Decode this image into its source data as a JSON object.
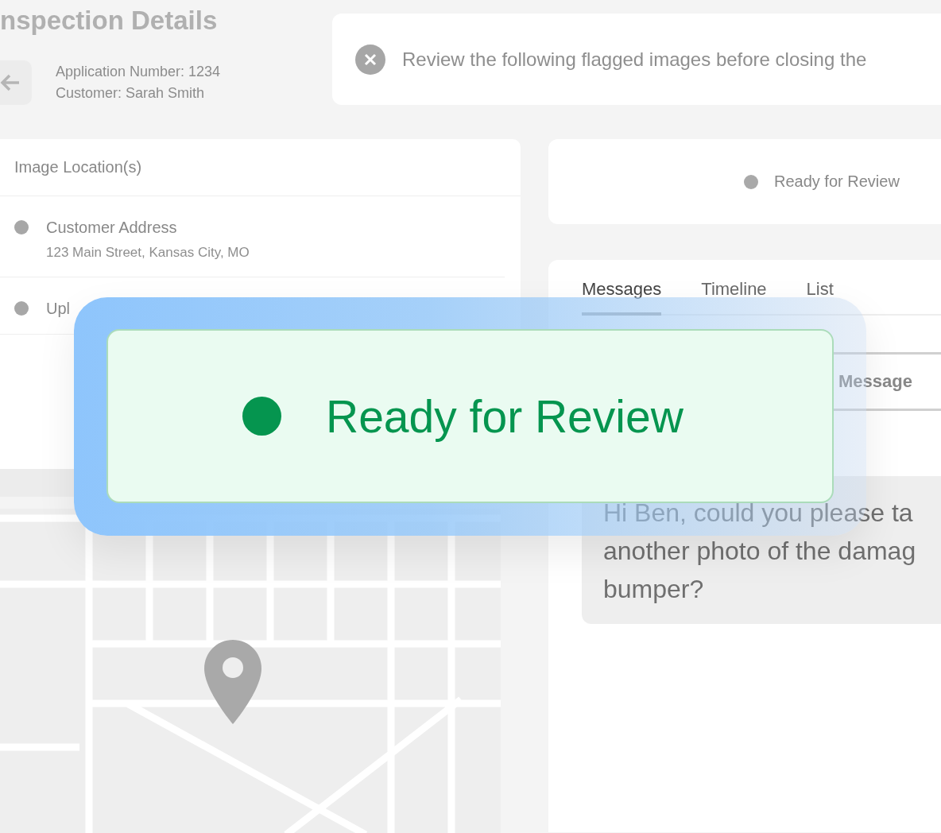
{
  "page": {
    "title": "nspection Details",
    "application_number": "Application Number: 1234",
    "customer": "Customer: Sarah Smith"
  },
  "alert": {
    "text": "Review the following flagged images before closing the"
  },
  "locations": {
    "title": "Image Location(s)",
    "items": [
      {
        "name": "Customer Address",
        "address": "123 Main Street, Kansas City, MO"
      },
      {
        "name": "Upl"
      }
    ]
  },
  "status_card": {
    "label": "Ready for Review"
  },
  "messages": {
    "tabs": [
      {
        "label": "Messages",
        "selected": true
      },
      {
        "label": "Timeline",
        "selected": false
      },
      {
        "label": "List",
        "selected": false
      }
    ],
    "field": {
      "placeholder": "Message"
    },
    "bubble": {
      "lines": [
        "Hi Ben, could you please ta",
        "another photo of the damag",
        "bumper?"
      ]
    }
  },
  "highlight": {
    "label": "Ready for Review"
  }
}
